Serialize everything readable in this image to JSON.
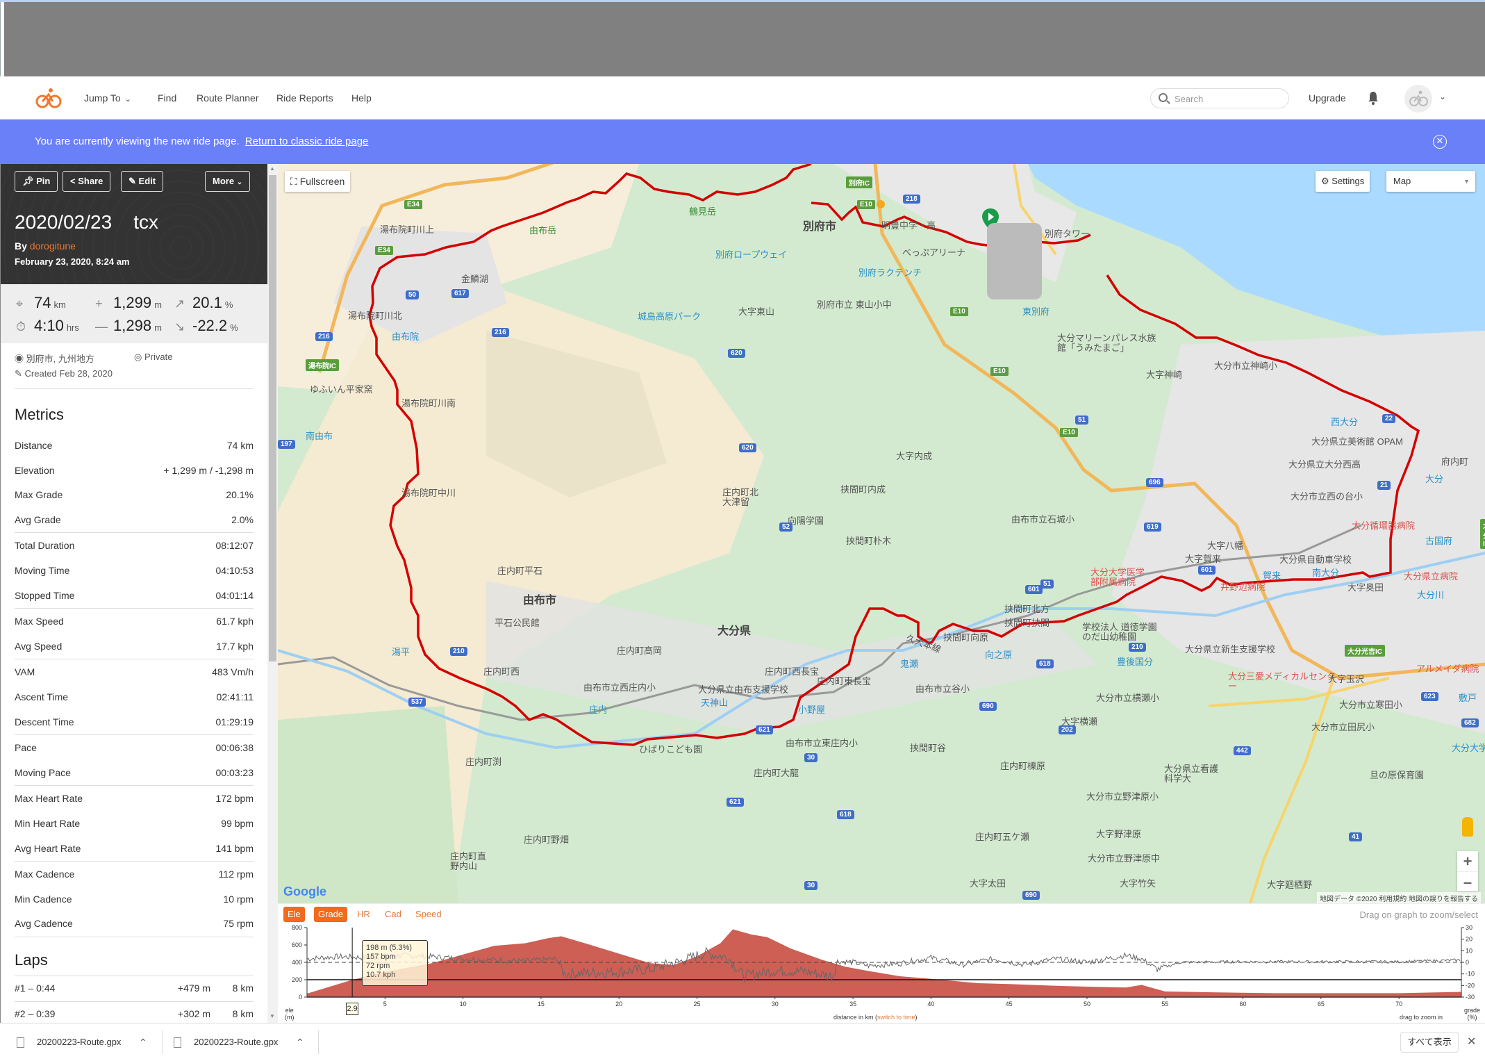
{
  "header": {
    "logo": "ride-logo",
    "nav": [
      {
        "label": "Jump To",
        "dropdown": true
      },
      {
        "label": "Find"
      },
      {
        "label": "Route Planner"
      },
      {
        "label": "Ride Reports"
      },
      {
        "label": "Help"
      }
    ],
    "search_placeholder": "Search",
    "upgrade_label": "Upgrade"
  },
  "banner": {
    "message": "You are currently viewing the new ride page.",
    "link": "Return to classic ride page"
  },
  "sidebar": {
    "buttons": {
      "pin": "Pin",
      "share": "Share",
      "edit": "Edit",
      "more": "More"
    },
    "title": "2020/02/23    tcx",
    "by_prefix": "By",
    "author": "dorogitune",
    "datetime": "February 23, 2020, 8:24 am",
    "stats": {
      "distance": {
        "value": "74",
        "unit": "km"
      },
      "duration": {
        "value": "4:10",
        "unit": "hrs"
      },
      "elev_gain": {
        "value": "1,299",
        "unit": "m"
      },
      "elev_loss": {
        "value": "1,298",
        "unit": "m"
      },
      "max_grade": {
        "value": "20.1",
        "unit": "%"
      },
      "min_grade": {
        "value": "-22.2",
        "unit": "%"
      }
    },
    "location": "別府市, 九州地方",
    "privacy": "Private",
    "created": "Created Feb 28, 2020",
    "metrics_heading": "Metrics",
    "metrics": [
      {
        "label": "Distance",
        "value": "74 km"
      },
      {
        "label": "Elevation",
        "value": "+ 1,299 m / -1,298 m"
      },
      {
        "label": "Max Grade",
        "value": "20.1%"
      },
      {
        "label": "Avg Grade",
        "value": "2.0%"
      },
      {
        "label": "Total Duration",
        "value": "08:12:07"
      },
      {
        "label": "Moving Time",
        "value": "04:10:53"
      },
      {
        "label": "Stopped Time",
        "value": "04:01:14"
      },
      {
        "label": "Max Speed",
        "value": "61.7 kph"
      },
      {
        "label": "Avg Speed",
        "value": "17.7 kph"
      },
      {
        "label": "VAM",
        "value": "483 Vm/h"
      },
      {
        "label": "Ascent Time",
        "value": "02:41:11"
      },
      {
        "label": "Descent Time",
        "value": "01:29:19"
      },
      {
        "label": "Pace",
        "value": "00:06:38"
      },
      {
        "label": "Moving Pace",
        "value": "00:03:23"
      },
      {
        "label": "Max Heart Rate",
        "value": "172 bpm"
      },
      {
        "label": "Min Heart Rate",
        "value": "99 bpm"
      },
      {
        "label": "Avg Heart Rate",
        "value": "141 bpm"
      },
      {
        "label": "Max Cadence",
        "value": "112 rpm"
      },
      {
        "label": "Min Cadence",
        "value": "10 rpm"
      },
      {
        "label": "Avg Cadence",
        "value": "75 rpm"
      }
    ],
    "laps_heading": "Laps",
    "laps": [
      {
        "label": "#1 – 0:44",
        "gain": "+479 m",
        "dist": "8 km"
      },
      {
        "label": "#2 – 0:39",
        "gain": "+302 m",
        "dist": "8 km"
      }
    ]
  },
  "map": {
    "fullscreen_label": "Fullscreen",
    "settings_label": "Settings",
    "maptype_selected": "Map",
    "google_label": "Google",
    "attribution": "地図データ ©2020   利用規約   地図の誤りを報告する",
    "labels": [
      {
        "text": "湯布院町川上"
      },
      {
        "text": "由布岳"
      },
      {
        "text": "鶴見岳"
      },
      {
        "text": "別府市"
      },
      {
        "text": "別府ロープウェイ"
      },
      {
        "text": "金鱗湖"
      },
      {
        "text": "湯布院町川北"
      },
      {
        "text": "由布院"
      },
      {
        "text": "城島高原パーク"
      },
      {
        "text": "大字東山"
      },
      {
        "text": "別府市立 東山小中"
      },
      {
        "text": "明豊中学・高"
      },
      {
        "text": "べっぷアリーナ"
      },
      {
        "text": "別府ラクテンチ"
      },
      {
        "text": "別府タワー"
      },
      {
        "text": "東別府"
      },
      {
        "text": "大分マリーンパレス水族館「うみたまご」"
      },
      {
        "text": "ゆふいん平家窯"
      },
      {
        "text": "湯布院町川南"
      },
      {
        "text": "南由布"
      },
      {
        "text": "湯布院IC"
      },
      {
        "text": "湯布院町中川"
      },
      {
        "text": "大分市立神崎小"
      },
      {
        "text": "大字神崎"
      },
      {
        "text": "西大分"
      },
      {
        "text": "大分県立美術館 OPAM"
      },
      {
        "text": "府内町"
      },
      {
        "text": "大分"
      },
      {
        "text": "大分県立大分西高"
      },
      {
        "text": "大分市立西の台小"
      },
      {
        "text": "由布市立石城小"
      },
      {
        "text": "大分IC"
      },
      {
        "text": "大分循環器病院"
      },
      {
        "text": "古国府"
      },
      {
        "text": "大字八幡"
      },
      {
        "text": "大字賀来"
      },
      {
        "text": "大分県自動車学校"
      },
      {
        "text": "南大分"
      },
      {
        "text": "大分県立病院"
      },
      {
        "text": "大分大学医学部附属病院"
      },
      {
        "text": "賀来"
      },
      {
        "text": "井野辺病院"
      },
      {
        "text": "大字奥田"
      },
      {
        "text": "庄内町平石"
      },
      {
        "text": "由布市"
      },
      {
        "text": "平石公民館"
      },
      {
        "text": "大分県"
      },
      {
        "text": "庄内町北大津留"
      },
      {
        "text": "向陽学園"
      },
      {
        "text": "挟間町朴木"
      },
      {
        "text": "挟間町内成"
      },
      {
        "text": "大字内成"
      },
      {
        "text": "挟間町北方"
      },
      {
        "text": "挟間町挟間"
      },
      {
        "text": "挟間町向原"
      },
      {
        "text": "向之原"
      },
      {
        "text": "学校法人 道徳学園 のだ山幼稚園"
      },
      {
        "text": "豊後国分"
      },
      {
        "text": "大分県立新生支援学校"
      },
      {
        "text": "大分光吉IC"
      },
      {
        "text": "アルメイダ病院"
      },
      {
        "text": "大分三愛メディカルセンター"
      },
      {
        "text": "大字玉沢"
      },
      {
        "text": "大分市立横瀬小"
      },
      {
        "text": "大分市立寒田小"
      },
      {
        "text": "敷戸"
      },
      {
        "text": "大分市立田尻小"
      },
      {
        "text": "大分大学前"
      },
      {
        "text": "鬼瀬"
      },
      {
        "text": "由布市立谷小"
      },
      {
        "text": "庄内町高岡"
      },
      {
        "text": "庄内町西"
      },
      {
        "text": "由布市立西庄内小"
      },
      {
        "text": "庄内"
      },
      {
        "text": "ひばりこども園"
      },
      {
        "text": "天神山"
      },
      {
        "text": "大分県立由布支援学校"
      },
      {
        "text": "庄内町西長宝"
      },
      {
        "text": "庄内町東長宝"
      },
      {
        "text": "小野屋"
      },
      {
        "text": "由布市立東庄内小"
      },
      {
        "text": "庄内町大龍"
      },
      {
        "text": "庄内町渕"
      },
      {
        "text": "湯平"
      },
      {
        "text": "庄内町櫟原"
      },
      {
        "text": "庄内町五ケ瀬"
      },
      {
        "text": "庄内町野畑"
      },
      {
        "text": "庄内町直野内山"
      },
      {
        "text": "挟間町谷"
      },
      {
        "text": "大字横瀬"
      },
      {
        "text": "大分県立看護科学大"
      },
      {
        "text": "大分市立野津原小"
      },
      {
        "text": "大字野津原"
      },
      {
        "text": "大分市立野津原中"
      },
      {
        "text": "大字竹矢"
      },
      {
        "text": "大字太田"
      },
      {
        "text": "大字廻栖野"
      },
      {
        "text": "旦の原保育園"
      },
      {
        "text": "久大本線"
      },
      {
        "text": "大分川"
      },
      {
        "text": "別府IC"
      }
    ]
  },
  "chart_tabs": [
    {
      "label": "Ele",
      "active": true
    },
    {
      "label": "Grade",
      "active": true
    },
    {
      "label": "HR",
      "active": false
    },
    {
      "label": "Cad",
      "active": false
    },
    {
      "label": "Speed",
      "active": false
    }
  ],
  "chart_hint": "Drag on graph to zoom/select",
  "tooltip": {
    "line1": "198 m (5.3%)",
    "line2": "157 bpm",
    "line3": "72 rpm",
    "line4": "10.7 kph"
  },
  "cursor_x_label": "2.9",
  "distance_axis_label": "distance in km",
  "switch_to_time": "switch to time",
  "drag_to_zoom": "drag to zoom in",
  "left_axis_title": "ele\n(m)",
  "right_axis_title": "grade\n(%)",
  "chart_data": {
    "type": "area",
    "title": "",
    "xlabel": "distance in km",
    "ylabel": "ele (m)",
    "y2label": "grade (%)",
    "xlim": [
      0,
      74
    ],
    "ylim": [
      0,
      800
    ],
    "y2lim": [
      -30,
      30
    ],
    "x_ticks": [
      5,
      10,
      15,
      20,
      25,
      30,
      35,
      40,
      45,
      50,
      55,
      60,
      65,
      70
    ],
    "y_ticks": [
      0,
      200,
      400,
      600,
      800
    ],
    "y2_ticks": [
      30,
      20,
      10,
      0,
      -10,
      -20,
      -30
    ],
    "series": [
      {
        "name": "Elevation",
        "kind": "area",
        "color": "#cd5f55",
        "x": [
          0,
          2.9,
          5,
          8,
          10,
          12,
          14,
          15.5,
          16.3,
          18,
          20,
          22,
          23.5,
          25,
          26.5,
          27.3,
          28.5,
          29.5,
          31,
          33,
          34.5,
          36,
          38,
          40,
          43,
          45,
          48,
          50,
          52.5,
          53.5,
          55,
          58,
          62,
          66,
          70,
          74
        ],
        "y": [
          40,
          198,
          290,
          390,
          490,
          590,
          620,
          680,
          700,
          610,
          500,
          390,
          370,
          470,
          620,
          780,
          720,
          690,
          560,
          430,
          350,
          300,
          240,
          210,
          160,
          150,
          130,
          120,
          110,
          140,
          65,
          55,
          45,
          45,
          45,
          60
        ]
      },
      {
        "name": "Grade",
        "kind": "line",
        "axis": "right",
        "color": "#666666",
        "x": [
          0,
          2,
          4,
          6,
          8,
          10,
          12,
          14,
          16,
          16.5,
          18,
          20,
          22,
          24,
          25.5,
          27,
          28,
          30,
          32,
          33.7,
          34,
          35,
          36,
          38,
          40,
          42,
          44,
          46,
          48,
          50,
          52.5,
          53.5,
          54.5,
          56,
          60,
          65,
          70,
          74
        ],
        "y": [
          3,
          5,
          4,
          6,
          5,
          3,
          2,
          1,
          3,
          -10,
          -9,
          -8,
          -6,
          1,
          8,
          4,
          -12,
          -7,
          -8,
          -12,
          1,
          0,
          -3,
          -1,
          4,
          -2,
          3,
          -2,
          3,
          0,
          6,
          3,
          -6,
          0,
          0.5,
          0.5,
          0.5,
          2
        ]
      }
    ],
    "reference_lines": [
      {
        "axis": "right",
        "value": 0,
        "style": "dashed"
      },
      {
        "axis": "left",
        "value": 200,
        "style": "solid"
      }
    ],
    "cursor": {
      "x": 2.9,
      "elevation_m": 198,
      "grade_pct": 5.3,
      "hr_bpm": 157,
      "cadence_rpm": 72,
      "speed_kph": 10.7
    }
  },
  "downloads": [
    {
      "filename": "20200223-Route.gpx"
    },
    {
      "filename": "20200223-Route.gpx"
    }
  ],
  "show_all_label": "すべて表示"
}
